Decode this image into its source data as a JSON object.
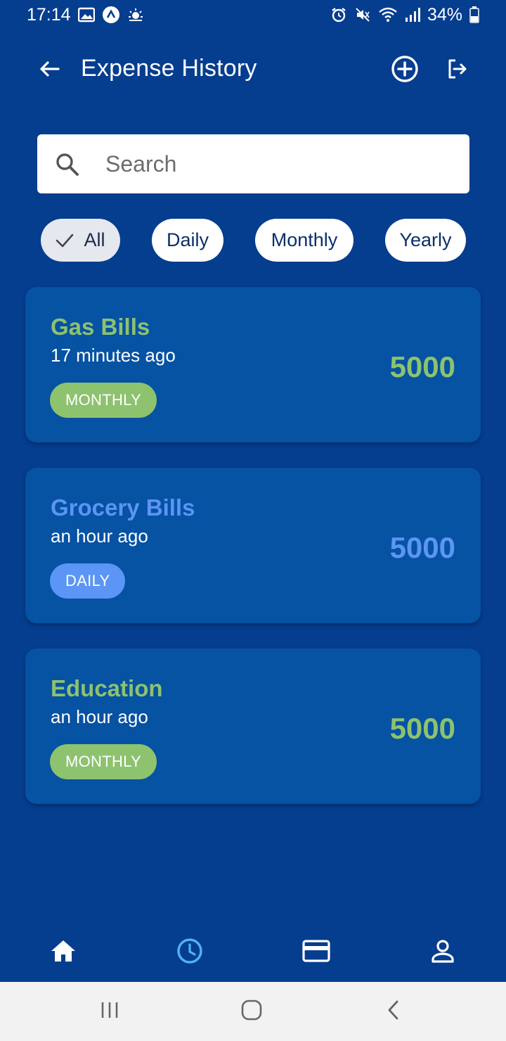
{
  "status_bar": {
    "time": "17:14",
    "battery": "34%",
    "left_icons": [
      "gallery-icon",
      "app-notification-icon",
      "weather-icon"
    ],
    "right_icons": [
      "alarm-icon",
      "mute-icon",
      "wifi-icon",
      "signal-icon",
      "battery-icon"
    ]
  },
  "app_bar": {
    "title": "Expense History",
    "back_icon": "arrow-left-icon",
    "add_icon": "add-circle-icon",
    "logout_icon": "logout-icon"
  },
  "search": {
    "placeholder": "Search",
    "value": ""
  },
  "filters": [
    {
      "label": "All",
      "selected": true
    },
    {
      "label": "Daily",
      "selected": false
    },
    {
      "label": "Monthly",
      "selected": false
    },
    {
      "label": "Yearly",
      "selected": false
    }
  ],
  "expenses": [
    {
      "title": "Gas Bills",
      "time": "17 minutes ago",
      "amount": "5000",
      "badge": "MONTHLY",
      "accent": "#8dc26f"
    },
    {
      "title": "Grocery Bills",
      "time": "an hour ago",
      "amount": "5000",
      "badge": "DAILY",
      "accent": "#5b95f5"
    },
    {
      "title": "Education",
      "time": "an hour ago",
      "amount": "5000",
      "badge": "MONTHLY",
      "accent": "#8dc26f"
    }
  ],
  "bottom_nav": {
    "items": [
      "home-icon",
      "history-icon",
      "card-icon",
      "profile-icon"
    ],
    "active": "history-icon",
    "active_color": "#4fb3f6"
  },
  "colors": {
    "background": "#053d8f",
    "card": "#0652a3",
    "monthly": "#8dc26f",
    "daily": "#5b95f5"
  }
}
